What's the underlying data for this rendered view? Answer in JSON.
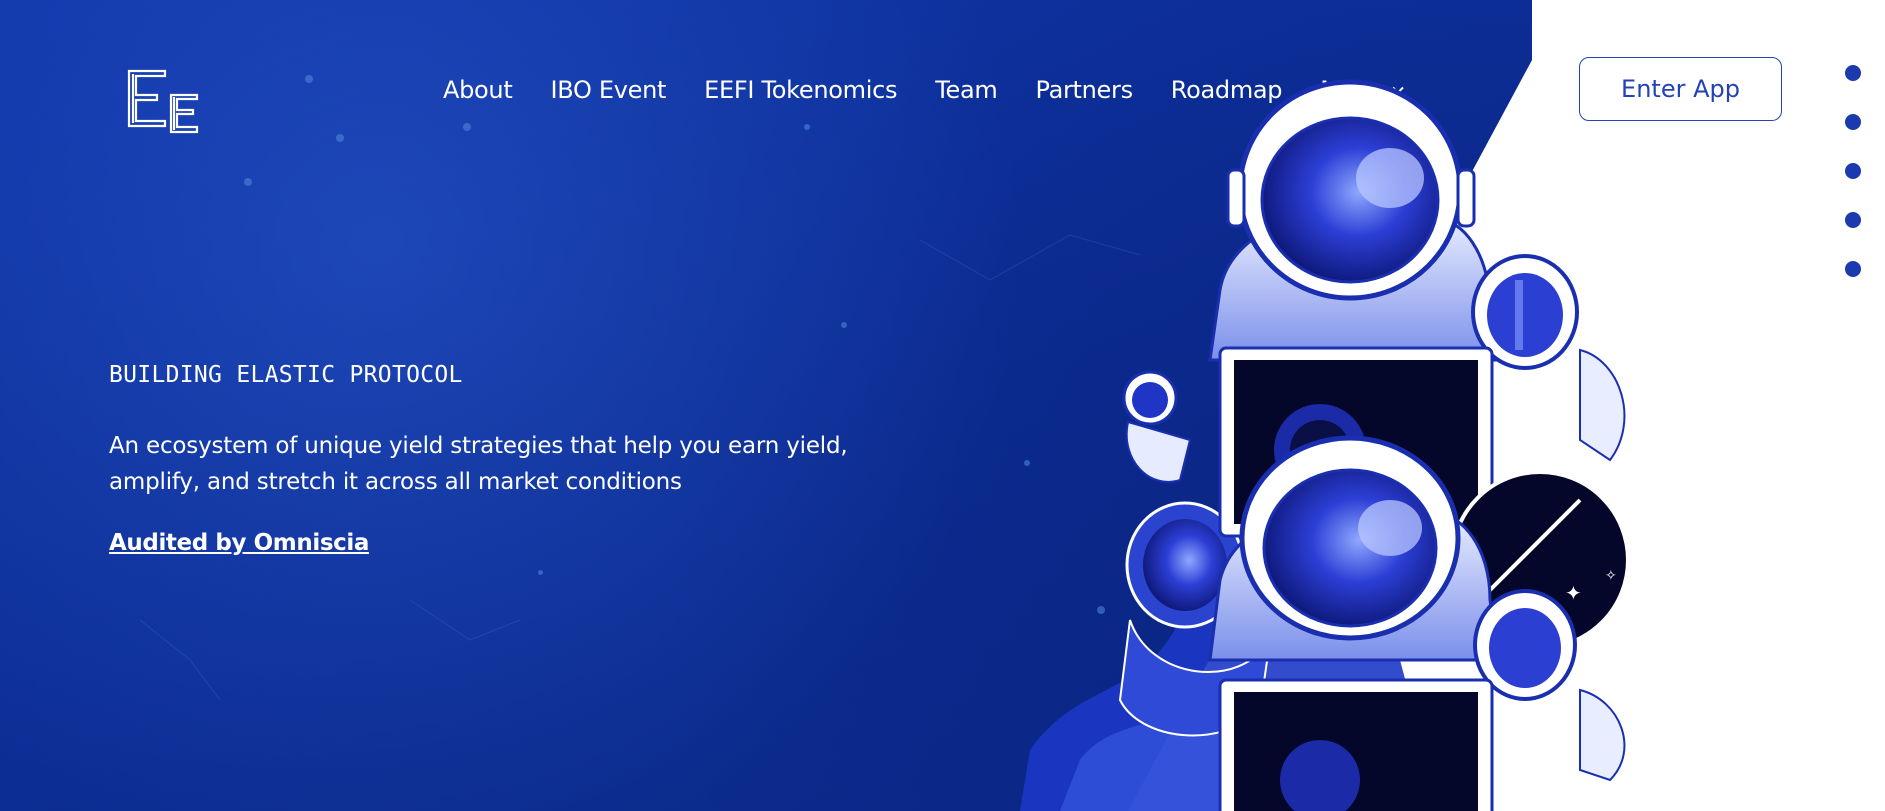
{
  "header": {
    "nav": [
      {
        "label": "About"
      },
      {
        "label": "IBO Event"
      },
      {
        "label": "EEFI Tokenomics"
      },
      {
        "label": "Team"
      },
      {
        "label": "Partners"
      },
      {
        "label": "Roadmap"
      },
      {
        "label": "More"
      }
    ],
    "cta_label": "Enter App"
  },
  "hero": {
    "kicker": "BUILDING ELASTIC PROTOCOL",
    "lead": "An ecosystem of unique yield strategies that help you earn yield, amplify, and stretch it across all market conditions",
    "audit_link": "Audited by Omniscia"
  },
  "colors": {
    "hero_blue": "#0c2e96",
    "accent": "#2342b8",
    "text": "#ffffff"
  },
  "icons": {
    "logo": "ee-logo",
    "more": "chevron-down-icon",
    "section_nav": "dot-icon"
  }
}
